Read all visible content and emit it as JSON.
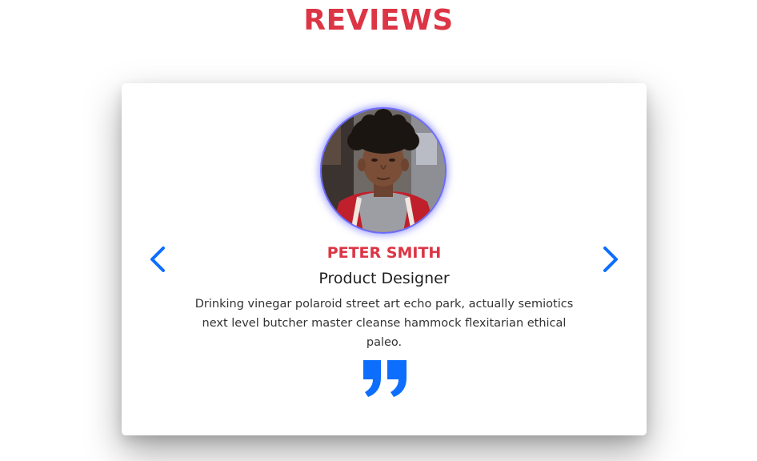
{
  "section": {
    "title": "REVIEWS"
  },
  "review": {
    "name": "PETER SMITH",
    "job": "Product Designer",
    "text": "Drinking vinegar polaroid street art echo park, actually semiotics next level butcher master cleanse hammock flexitarian ethical paleo.",
    "avatar_icon": "person-photo"
  },
  "controls": {
    "prev_icon": "chevron-left-icon",
    "next_icon": "chevron-right-icon",
    "quote_icon": "quote-right-icon"
  },
  "colors": {
    "accent_red": "#dc3545",
    "accent_blue": "#0d6efd",
    "avatar_ring": "#6b6bff"
  }
}
